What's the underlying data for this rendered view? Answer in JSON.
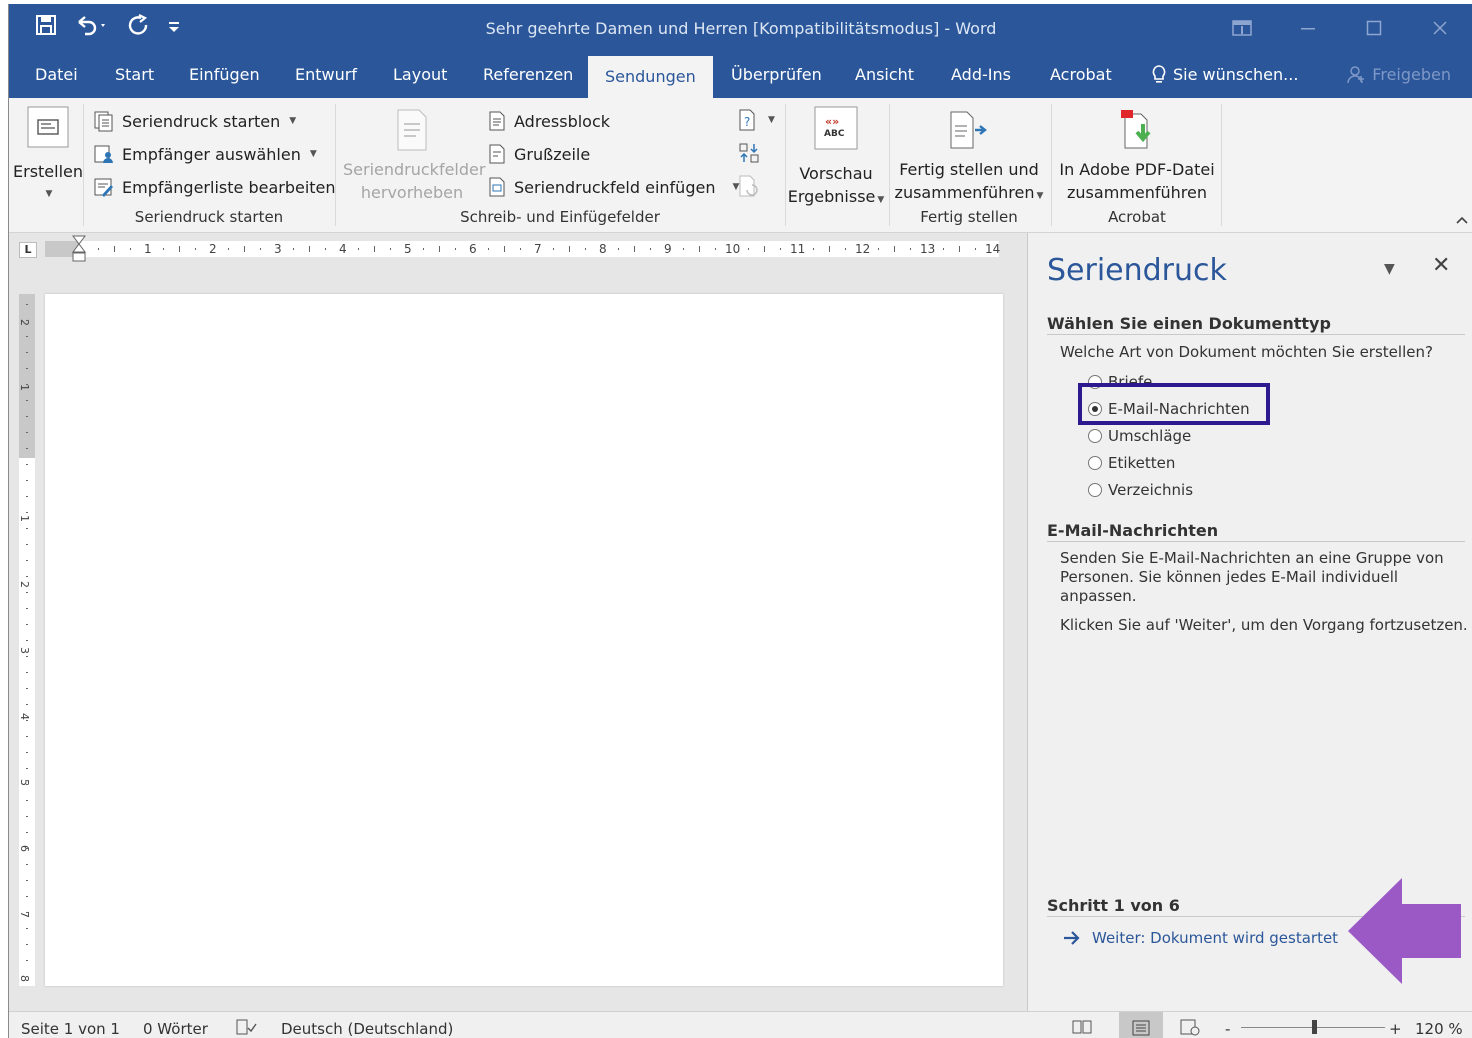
{
  "window": {
    "title": "Sehr geehrte Damen und Herren [Kompatibilitätsmodus]  -  Word"
  },
  "tabs": [
    "Datei",
    "Start",
    "Einfügen",
    "Entwurf",
    "Layout",
    "Referenzen",
    "Sendungen",
    "Überprüfen",
    "Ansicht",
    "Add-Ins",
    "Acrobat"
  ],
  "tell_me": "Sie wünschen...",
  "share": "Freigeben",
  "ribbon": {
    "erstellen": "Erstellen",
    "seriendruck_starten_btn": "Seriendruck starten",
    "empfaenger_auswaehlen": "Empfänger auswählen",
    "empfaengerliste_bearbeiten": "Empfängerliste bearbeiten",
    "group_seriendruck_starten": "Seriendruck starten",
    "hervorheben_line1": "Seriendruckfelder",
    "hervorheben_line2": "hervorheben",
    "adressblock": "Adressblock",
    "grusszeile": "Grußzeile",
    "feld_einfuegen": "Seriendruckfeld einfügen",
    "group_schreib": "Schreib- und Einfügefelder",
    "vorschau_line1": "Vorschau",
    "vorschau_line2": "Ergebnisse",
    "fertig_line1": "Fertig stellen und",
    "fertig_line2": "zusammenführen",
    "group_fertig": "Fertig stellen",
    "adobe_line1": "In Adobe PDF-Datei",
    "adobe_line2": "zusammenführen",
    "group_acrobat": "Acrobat"
  },
  "ruler": {
    "h_numbers": [
      "1",
      "2",
      "3",
      "4",
      "5",
      "6",
      "7",
      "8",
      "9",
      "10",
      "11",
      "12",
      "13",
      "14"
    ],
    "v_numbers": [
      "2",
      "1",
      "1",
      "2",
      "3",
      "4",
      "5",
      "6",
      "7",
      "8"
    ]
  },
  "pane": {
    "title": "Seriendruck",
    "section1": "Wählen Sie einen Dokumenttyp",
    "question": "Welche Art von Dokument möchten Sie erstellen?",
    "options": [
      "Briefe",
      "E-Mail-Nachrichten",
      "Umschläge",
      "Etiketten",
      "Verzeichnis"
    ],
    "selected": "E-Mail-Nachrichten",
    "section2": "E-Mail-Nachrichten",
    "desc_line1": "Senden Sie E-Mail-Nachrichten an eine Gruppe von",
    "desc_line2": "Personen. Sie können jedes E-Mail individuell",
    "desc_line3": "anpassen.",
    "continue_text": "Klicken Sie auf 'Weiter', um den Vorgang fortzusetzen.",
    "step": "Schritt 1 von 6",
    "next": "Weiter: Dokument wird gestartet"
  },
  "status": {
    "page": "Seite 1 von 1",
    "words": "0 Wörter",
    "language": "Deutsch (Deutschland)",
    "zoom": "120 %",
    "zoom_minus": "-",
    "zoom_plus": "+"
  },
  "colors": {
    "brand": "#2b579a",
    "highlight_box": "#2e1a8f",
    "callout_arrow": "#9b59c6"
  }
}
